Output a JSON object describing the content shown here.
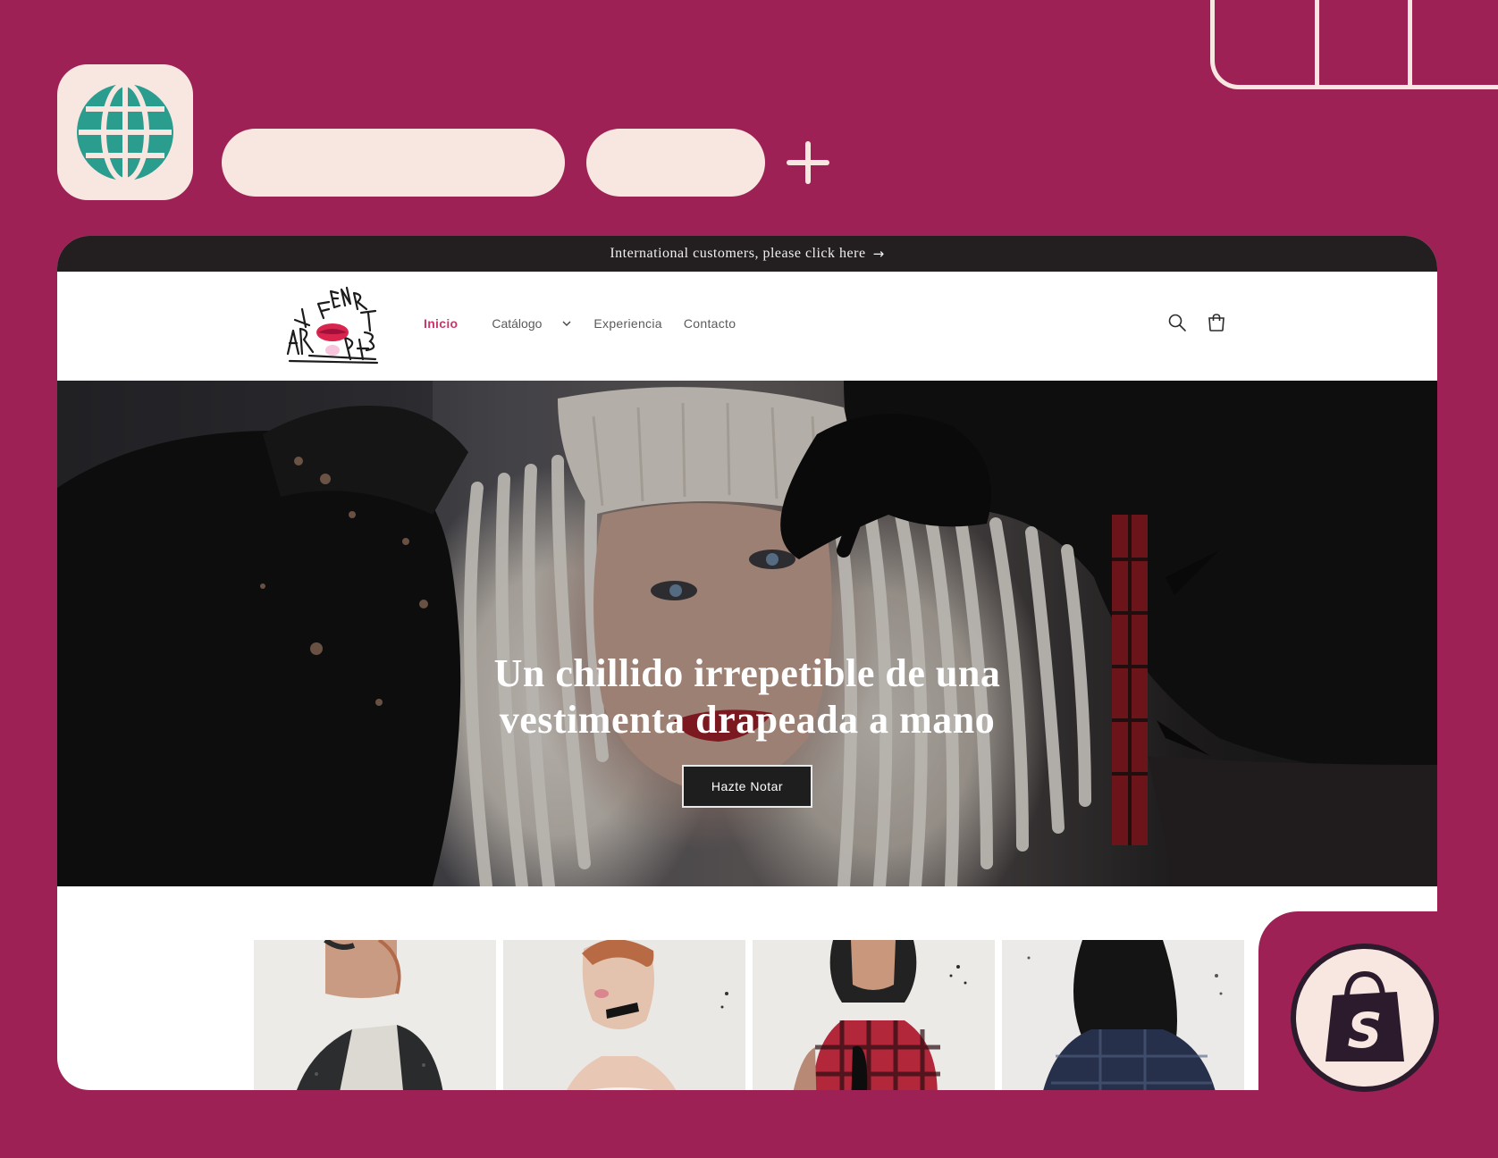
{
  "colors": {
    "frame_background": "#9e2155",
    "cream": "#f8e7e1",
    "globe_teal": "#2a9d8f",
    "announcement_bg": "#231f20",
    "nav_active": "#c6366d",
    "shopify_dark": "#2c1b2c"
  },
  "browser": {
    "globe_icon": "globe-icon",
    "new_tab_icon": "plus-icon"
  },
  "announcement": {
    "text": "International customers, please click here",
    "arrow": "→"
  },
  "header": {
    "logo_alt": "logo",
    "nav": [
      {
        "label": "Inicio",
        "active": true
      },
      {
        "label": "Catálogo",
        "dropdown": true
      },
      {
        "label": "Experiencia"
      },
      {
        "label": "Contacto"
      }
    ],
    "search_icon": "search-icon",
    "cart_icon": "cart-icon"
  },
  "hero": {
    "title": "Un chillido irrepetible de una vestimenta drapeada a mano",
    "button_label": "Hazte Notar"
  },
  "products": [
    {
      "image": "product-image-1"
    },
    {
      "image": "product-image-2"
    },
    {
      "image": "product-image-3"
    },
    {
      "image": "product-image-4"
    }
  ],
  "badge": {
    "icon": "shopify-bag-icon",
    "letter": "S"
  }
}
